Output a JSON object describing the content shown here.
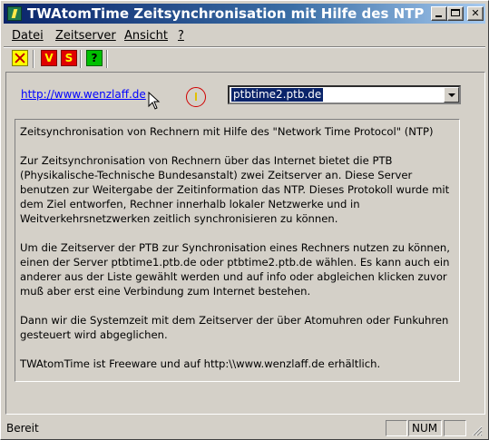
{
  "window": {
    "title": "TWAtomTime Zeitsynchronisation mit Hilfe des NTP",
    "app_icon": "lightning-icon",
    "controls": {
      "minimize": "minimize-icon",
      "maximize": "maximize-icon",
      "close_label": "✕"
    }
  },
  "menu": {
    "items": [
      {
        "label": "Datei"
      },
      {
        "label": "Zeitserver"
      },
      {
        "label": "Ansicht"
      },
      {
        "label": "?"
      }
    ]
  },
  "toolbar": {
    "buttons": [
      {
        "icon": "cancel-x-icon",
        "label": ""
      },
      {
        "icon": "v-icon",
        "label": "V"
      },
      {
        "icon": "s-icon",
        "label": "S"
      },
      {
        "icon": "help-icon",
        "label": "?"
      }
    ]
  },
  "main": {
    "link": "http://www.wenzlaff.de",
    "server_select": {
      "value": "ptbtime2.ptb.de"
    },
    "paragraphs": [
      "Zeitsynchronisation von Rechnern mit Hilfe des \"Network Time Protocol\" (NTP)",
      "Zur Zeitsynchronisation von Rechnern über das Internet bietet die PTB (Physikalische-Technische Bundesanstalt) zwei Zeitserver an. Diese Server benutzen zur Weitergabe der Zeitinformation das NTP. Dieses Protokoll wurde mit dem Ziel entworfen, Rechner innerhalb lokaler Netzwerke und  in Weitverkehrsnetzwerken zeitlich synchronisieren zu können.",
      "Um die Zeitserver der PTB zur Synchronisation eines Rechners nutzen zu können, einen der Server ptbtime1.ptb.de oder ptbtime2.ptb.de wählen. Es kann auch ein anderer aus der Liste gewählt werden und auf info oder abgleichen klicken zuvor muß aber erst eine Verbindung zum Internet bestehen.",
      "Dann wir die Systemzeit mit dem Zeitserver der über Atomuhren oder Funkuhren gesteuert wird abgeglichen.",
      "TWAtomTime ist Freeware und auf http:\\\\www.wenzlaff.de erhältlich."
    ]
  },
  "statusbar": {
    "text": "Bereit",
    "panes": [
      "",
      "NUM",
      ""
    ]
  },
  "colors": {
    "title_gradient_start": "#0a246a",
    "title_gradient_end": "#a6caf0",
    "face": "#d4d0c8",
    "link": "#0000ff",
    "selection": "#0a246a"
  }
}
